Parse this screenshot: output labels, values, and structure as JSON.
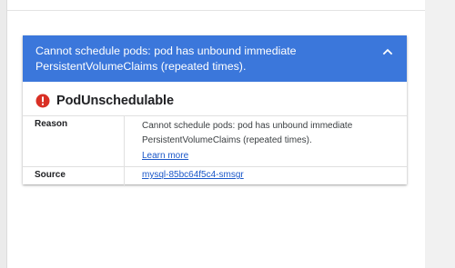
{
  "banner": {
    "message": "Cannot schedule pods: pod has unbound immediate PersistentVolumeClaims (repeated times).",
    "background_color": "#3b77db",
    "collapse_icon": "chevron-up-icon"
  },
  "event": {
    "title": "PodUnschedulable",
    "status_icon": "error-icon",
    "status_color": "#d93025"
  },
  "details": {
    "reason": {
      "label": "Reason",
      "value": "Cannot schedule pods: pod has unbound immediate PersistentVolumeClaims (repeated times).",
      "link_label": "Learn more"
    },
    "source": {
      "label": "Source",
      "value": "mysql-85bc64f5c4-smsgr"
    }
  }
}
